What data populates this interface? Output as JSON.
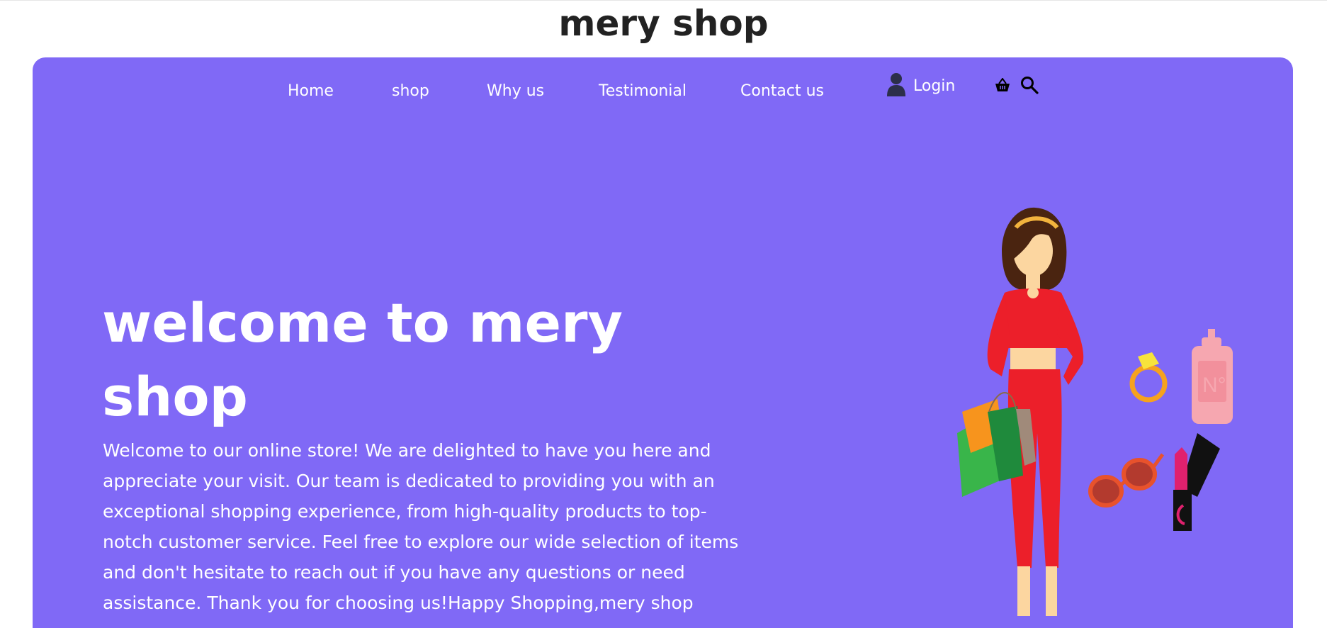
{
  "site": {
    "title": "mery shop"
  },
  "nav": {
    "items": [
      {
        "label": "Home"
      },
      {
        "label": "shop"
      },
      {
        "label": "Why us"
      },
      {
        "label": "Testimonial"
      },
      {
        "label": "Contact us"
      }
    ],
    "login_label": "Login"
  },
  "icons": {
    "user": "user-icon",
    "cart": "shopping-basket-icon",
    "search": "search-icon"
  },
  "hero": {
    "headline": "welcome to mery shop",
    "intro": "Welcome to our online store! We are delighted to have you here and appreciate your visit. Our team is dedicated to providing you with an exceptional shopping experience, from high-quality products to top-notch customer service. Feel free to explore our wide selection of items and don't hesitate to reach out if you have any questions or need assistance. Thank you for choosing us!Happy Shopping,mery shop",
    "illustration_perfume_label": "N°"
  },
  "colors": {
    "hero_background": "#8069f6",
    "title_text": "#222222",
    "nav_text": "#ffffff"
  }
}
